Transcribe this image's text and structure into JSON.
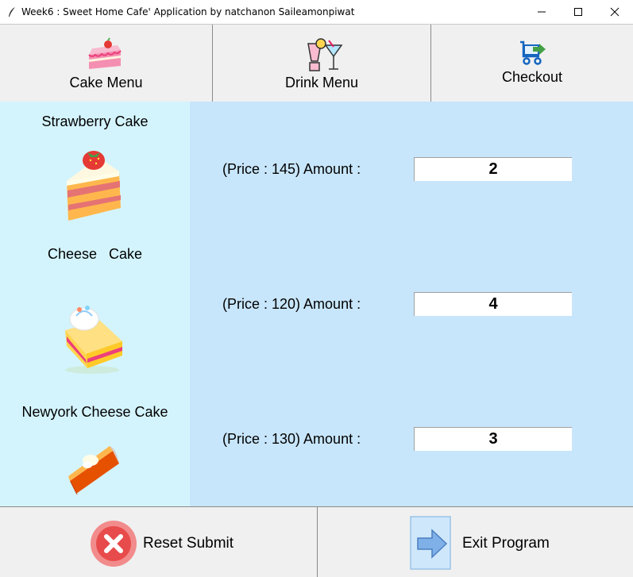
{
  "window": {
    "title": "Week6 : Sweet Home Cafe' Application by natchanon Saileamonpiwat",
    "minimize_glyph": "—",
    "maximize_glyph": "☐",
    "close_glyph": "✕"
  },
  "menu": {
    "cake_label": "Cake Menu",
    "drink_label": "Drink Menu",
    "checkout_label": "Checkout"
  },
  "items": [
    {
      "name": "Strawberry Cake",
      "price_text": "(Price : 145) Amount :",
      "amount": "2",
      "icon": "strawberry-cake-icon"
    },
    {
      "name": "Cheese   Cake",
      "price_text": "(Price : 120) Amount :",
      "amount": "4",
      "icon": "cheese-cake-icon"
    },
    {
      "name": "Newyork Cheese Cake",
      "price_text": "(Price : 130) Amount :",
      "amount": "3",
      "icon": "newyork-cheese-cake-icon"
    }
  ],
  "bottom": {
    "reset_label": "Reset Submit",
    "exit_label": "Exit Program"
  },
  "colors": {
    "left_panel": "#d4f4fd",
    "right_panel": "#c8e6fb",
    "reset_icon": "#e84b4b",
    "exit_arrow": "#7fb0e8"
  }
}
